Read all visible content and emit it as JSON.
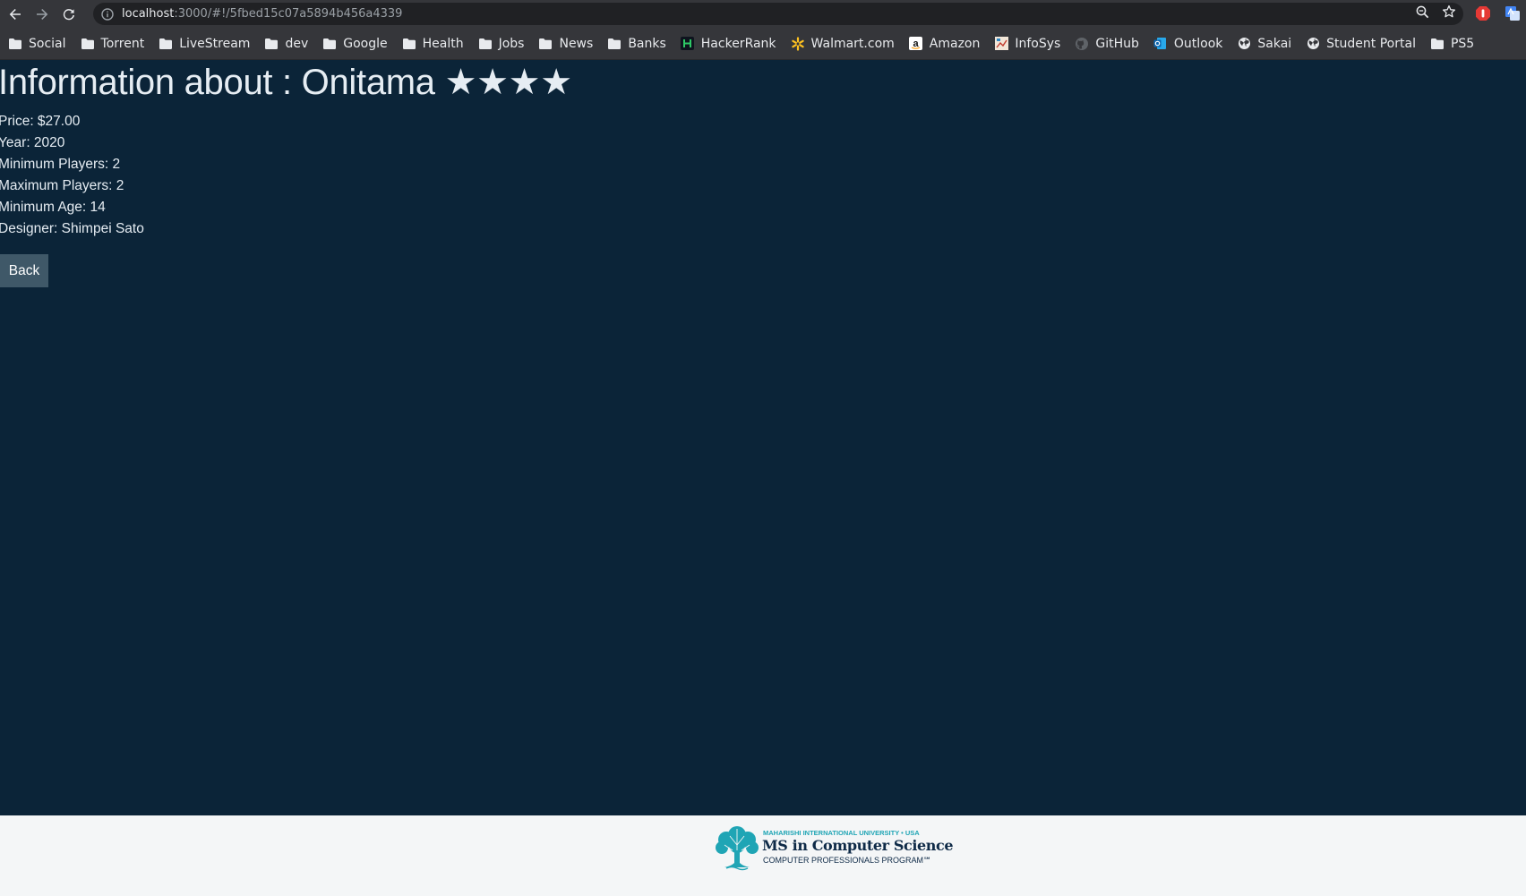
{
  "browser": {
    "url_host": "localhost",
    "url_rest": ":3000/#!/5fbed15c07a5894b456a4339",
    "bookmarks": [
      {
        "label": "Social",
        "icon": "folder-icon"
      },
      {
        "label": "Torrent",
        "icon": "folder-icon"
      },
      {
        "label": "LiveStream",
        "icon": "folder-icon"
      },
      {
        "label": "dev",
        "icon": "folder-icon"
      },
      {
        "label": "Google",
        "icon": "folder-icon"
      },
      {
        "label": "Health",
        "icon": "folder-icon"
      },
      {
        "label": "Jobs",
        "icon": "folder-icon"
      },
      {
        "label": "News",
        "icon": "folder-icon"
      },
      {
        "label": "Banks",
        "icon": "folder-icon"
      },
      {
        "label": "HackerRank",
        "icon": "hackerrank-icon"
      },
      {
        "label": "Walmart.com",
        "icon": "walmart-icon"
      },
      {
        "label": "Amazon",
        "icon": "amazon-icon"
      },
      {
        "label": "InfoSys",
        "icon": "infosys-icon"
      },
      {
        "label": "GitHub",
        "icon": "github-icon"
      },
      {
        "label": "Outlook",
        "icon": "outlook-icon"
      },
      {
        "label": "Sakai",
        "icon": "globe-icon"
      },
      {
        "label": "Student Portal",
        "icon": "globe-icon"
      },
      {
        "label": "PS5",
        "icon": "folder-icon"
      }
    ]
  },
  "game": {
    "heading_prefix": "Information about : ",
    "name": "Onitama",
    "stars": "★★★★",
    "rating": 4,
    "details": [
      "Price: $27.00",
      "Year: 2020",
      "Minimum Players: 2",
      "Maximum Players: 2",
      "Minimum Age: 14",
      "Designer: Shimpei Sato"
    ]
  },
  "actions": {
    "back_label": "Back"
  },
  "footer": {
    "logo_line1": "MAHARISHI INTERNATIONAL UNIVERSITY • USA",
    "logo_line2": "MS in Computer Science",
    "logo_line3": "COMPUTER PROFESSIONALS PROGRAM℠"
  },
  "colors": {
    "page_background": "#0b2438",
    "text": "#e6edf3",
    "button": "#3f5868",
    "footer_background": "#f4f6f7",
    "logo_teal": "#1fa5b5"
  }
}
